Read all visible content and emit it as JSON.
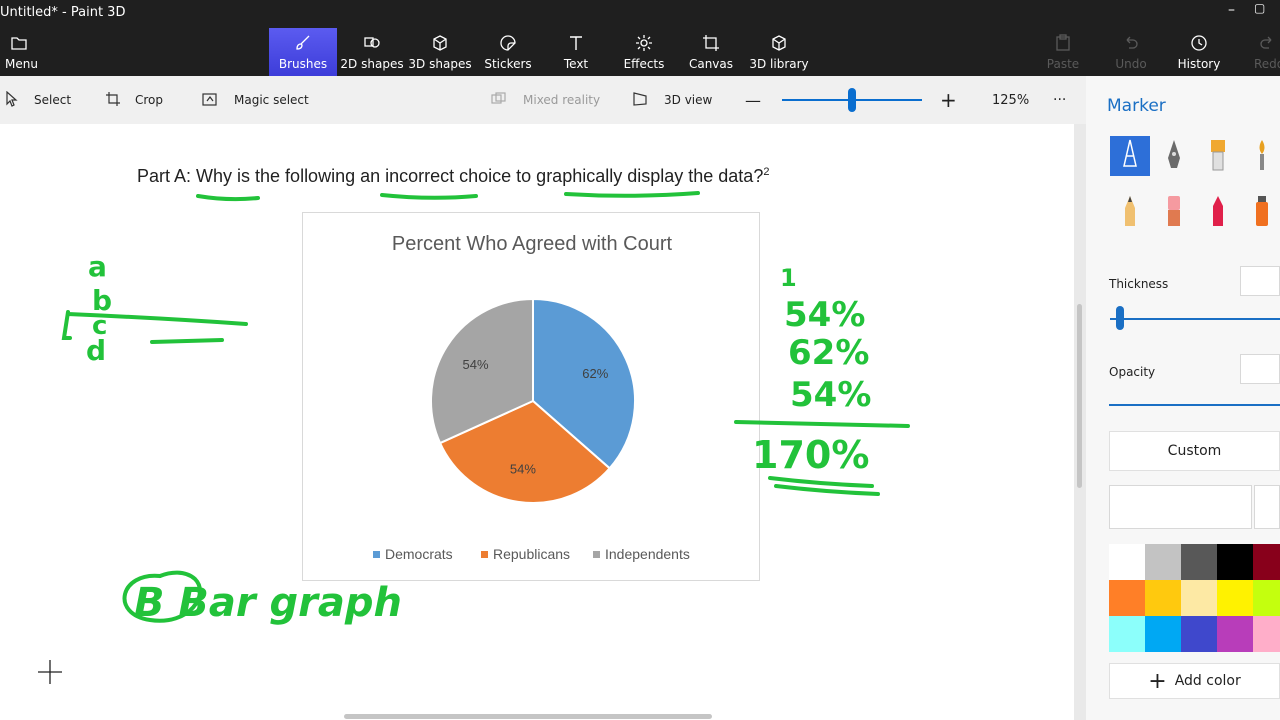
{
  "window": {
    "title": "Untitled* - Paint 3D",
    "minimize_glyph": "–",
    "maximize_glyph": "▢"
  },
  "ribbon": {
    "menu": {
      "label": "Menu",
      "icon": "folder-icon"
    },
    "tools": [
      {
        "label": "Brushes",
        "icon": "brush-icon",
        "active": true
      },
      {
        "label": "2D shapes",
        "icon": "shapes-icon"
      },
      {
        "label": "3D shapes",
        "icon": "cube-icon"
      },
      {
        "label": "Stickers",
        "icon": "sticker-icon"
      },
      {
        "label": "Text",
        "icon": "text-icon"
      },
      {
        "label": "Effects",
        "icon": "sun-icon"
      },
      {
        "label": "Canvas",
        "icon": "canvas-icon"
      },
      {
        "label": "3D library",
        "icon": "library-icon"
      }
    ],
    "right_tools": [
      {
        "label": "Paste",
        "icon": "clipboard-icon",
        "enabled": false
      },
      {
        "label": "Undo",
        "icon": "undo-icon",
        "enabled": false
      },
      {
        "label": "History",
        "icon": "history-icon",
        "enabled": true
      },
      {
        "label": "Redo",
        "icon": "redo-icon",
        "enabled": false
      }
    ]
  },
  "toolbar": {
    "select": "Select",
    "crop": "Crop",
    "magic_select": "Magic select",
    "mixed_reality": "Mixed reality",
    "view_3d": "3D view",
    "zoom_minus": "—",
    "zoom_plus": "+",
    "zoom": "125%",
    "more": "···"
  },
  "canvas": {
    "question_main": "Part A: Why is the following an incorrect choice to graphically display the data?",
    "question_sup": "2",
    "annotations": {
      "letters": [
        "a",
        "b",
        "c",
        "d"
      ],
      "answer": "B  Bar graph",
      "sum_lines": [
        "54%",
        "62%",
        "54%",
        "170%"
      ],
      "tick": "1"
    }
  },
  "chart_data": {
    "type": "pie",
    "title": "Percent Who Agreed with Court",
    "categories": [
      "Democrats",
      "Republicans",
      "Independents"
    ],
    "values": [
      62,
      54,
      54
    ],
    "data_labels": [
      "62%",
      "54%",
      "54%"
    ],
    "colors": [
      "#5b9bd5",
      "#ed7d31",
      "#a5a5a5"
    ],
    "legend": "bottom",
    "start_angle": "12 o'clock, clockwise"
  },
  "panel": {
    "title": "Marker",
    "brushes": [
      {
        "name": "Marker",
        "icon": "marker-brush-icon",
        "selected": true
      },
      {
        "name": "Calligraphy pen",
        "icon": "calligraphy-pen-icon"
      },
      {
        "name": "Oil brush",
        "icon": "oil-brush-icon"
      },
      {
        "name": "Watercolor",
        "icon": "watercolor-brush-icon"
      },
      {
        "name": "Pencil",
        "icon": "pencil-icon"
      },
      {
        "name": "Eraser",
        "icon": "eraser-icon"
      },
      {
        "name": "Crayon",
        "icon": "crayon-icon"
      },
      {
        "name": "Spray can",
        "icon": "spray-can-icon"
      }
    ],
    "thickness_label": "Thickness",
    "opacity_label": "Opacity",
    "custom_label": "Custom",
    "add_color_label": "Add color",
    "add_color_glyph": "+",
    "palette": [
      "#ffffff",
      "#c3c3c3",
      "#585858",
      "#000000",
      "#88001b",
      "#ff7f27",
      "#ffc90e",
      "#fde9a4",
      "#fff200",
      "#c4ff0e",
      "#8cfffb",
      "#00a8f3",
      "#3f48cc",
      "#b83dba",
      "#ffaec9"
    ]
  }
}
